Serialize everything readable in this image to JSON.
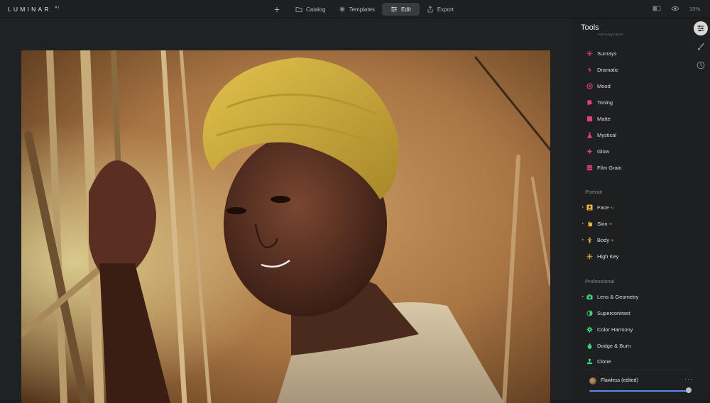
{
  "app": {
    "brand": "LUMINAR",
    "brand_suffix": "AI"
  },
  "nav": {
    "items": [
      {
        "label": "Catalog",
        "icon": "folder-icon"
      },
      {
        "label": "Templates",
        "icon": "sparkle-icon"
      },
      {
        "label": "Edit",
        "icon": "sliders-icon",
        "active": true
      },
      {
        "label": "Export",
        "icon": "share-icon"
      }
    ]
  },
  "top_right": {
    "zoom": "33%"
  },
  "panel": {
    "title": "Tools",
    "cutoff_item": "Atmosphere",
    "creative": [
      {
        "label": "Sunrays",
        "icon": "sun-icon",
        "color": "#e0407a"
      },
      {
        "label": "Dramatic",
        "icon": "bolt-icon",
        "color": "#e0407a"
      },
      {
        "label": "Mood",
        "icon": "mood-icon",
        "color": "#e0407a"
      },
      {
        "label": "Toning",
        "icon": "toning-icon",
        "color": "#e0407a"
      },
      {
        "label": "Matte",
        "icon": "matte-icon",
        "color": "#e0407a"
      },
      {
        "label": "Mystical",
        "icon": "flask-icon",
        "color": "#e0407a"
      },
      {
        "label": "Glow",
        "icon": "glow-icon",
        "color": "#e0407a"
      },
      {
        "label": "Film Grain",
        "icon": "film-icon",
        "color": "#e0407a"
      }
    ],
    "portrait_header": "Portrait",
    "portrait": [
      {
        "label": "Face",
        "badge": "AI",
        "icon": "face-icon",
        "color": "#f0b93a",
        "expandable": true
      },
      {
        "label": "Skin",
        "badge": "AI",
        "icon": "hand-icon",
        "color": "#f0b93a",
        "expandable": true
      },
      {
        "label": "Body",
        "badge": "AI",
        "icon": "body-icon",
        "color": "#f0b93a",
        "expandable": true
      },
      {
        "label": "High Key",
        "icon": "sun-rays-icon",
        "color": "#f0b93a",
        "expandable": false
      }
    ],
    "professional_header": "Professional",
    "professional": [
      {
        "label": "Lens & Geometry",
        "icon": "camera-icon",
        "color": "#3fd47a",
        "expandable": true
      },
      {
        "label": "Supercontrast",
        "icon": "contrast-icon",
        "color": "#3fd47a",
        "expandable": false
      },
      {
        "label": "Color Harmony",
        "icon": "gear-flower-icon",
        "color": "#3fd47a",
        "expandable": false
      },
      {
        "label": "Dodge & Burn",
        "icon": "drop-icon",
        "color": "#3fd47a",
        "expandable": false
      },
      {
        "label": "Clone",
        "icon": "stamp-icon",
        "color": "#3fd47a",
        "expandable": false
      }
    ]
  },
  "preset": {
    "name": "Flawless (edited)",
    "amount": 1.0
  },
  "colors": {
    "accent": "#5b8de8",
    "creative": "#e0407a",
    "portrait": "#f0b93a",
    "professional": "#3fd47a"
  }
}
